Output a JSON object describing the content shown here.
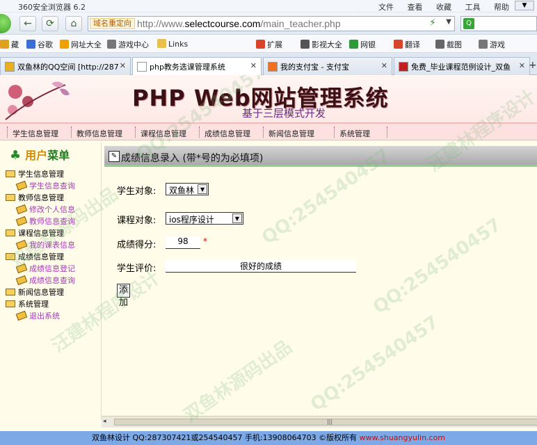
{
  "browser": {
    "app_title": "360安全浏览器 6.2",
    "menus": [
      "文件",
      "查看",
      "收藏",
      "工具",
      "帮助"
    ],
    "redirect_label": "域名重定向",
    "url_prefix": "http://www.",
    "url_domain": "selectcourse.com",
    "url_path": "/main_teacher.php"
  },
  "bookmarks": [
    {
      "label": "藏",
      "icon": "bookmark-icon",
      "color": "#e0a020"
    },
    {
      "label": "谷歌",
      "icon": "google-icon",
      "color": "#3b6fd8"
    },
    {
      "label": "网址大全",
      "icon": "site-icon",
      "color": "#f0a000"
    },
    {
      "label": "游戏中心",
      "icon": "game-icon",
      "color": "#777777"
    },
    {
      "label": "Links",
      "icon": "folder-icon",
      "color": "#e8c050"
    },
    {
      "label": "扩展",
      "icon": "extension-icon",
      "color": "#d9452b"
    },
    {
      "label": "影视大全",
      "icon": "video-icon",
      "color": "#555555"
    },
    {
      "label": "网银",
      "icon": "bank-icon",
      "color": "#2e9a3a"
    },
    {
      "label": "翻译",
      "icon": "translate-icon",
      "color": "#d9452b"
    },
    {
      "label": "截图",
      "icon": "screenshot-icon",
      "color": "#666666"
    },
    {
      "label": "游戏",
      "icon": "gamepad-icon",
      "color": "#777777"
    }
  ],
  "tabs": [
    {
      "label": "双鱼林的QQ空间 [http://287",
      "color": "#e8b020"
    },
    {
      "label": "php教务选课管理系统",
      "color": "#ffffff"
    },
    {
      "label": "我的支付宝 - 支付宝",
      "color": "#f07020"
    },
    {
      "label": "免费_毕业课程范例设计_双鱼",
      "color": "#c02020"
    }
  ],
  "site": {
    "title": "PHP Web网站管理系统",
    "subtitle": "基于三层模式开发",
    "topnav": [
      "学生信息管理",
      "教师信息管理",
      "课程信息管理",
      "成绩信息管理",
      "新闻信息管理",
      "系统管理"
    ]
  },
  "sidebar": {
    "head_user": "用户",
    "head_menu": "菜单",
    "items": [
      {
        "label": "学生信息管理",
        "level": "top"
      },
      {
        "label": "学生信息查询",
        "level": "sub"
      },
      {
        "label": "教师信息管理",
        "level": "top"
      },
      {
        "label": "修改个人信息",
        "level": "sub"
      },
      {
        "label": "教师信息查询",
        "level": "sub"
      },
      {
        "label": "课程信息管理",
        "level": "top"
      },
      {
        "label": "我的课表信息",
        "level": "sub"
      },
      {
        "label": "成绩信息管理",
        "level": "top"
      },
      {
        "label": "成绩信息登记",
        "level": "sub"
      },
      {
        "label": "成绩信息查询",
        "level": "sub"
      },
      {
        "label": "新闻信息管理",
        "level": "top"
      },
      {
        "label": "系统管理",
        "level": "top"
      },
      {
        "label": "退出系统",
        "level": "sub"
      }
    ]
  },
  "form": {
    "heading": "成绩信息录入 (带*号的为必填项)",
    "student_label": "学生对象:",
    "student_value": "双鱼林",
    "course_label": "课程对象:",
    "course_value": "ios程序设计",
    "score_label": "成绩得分:",
    "score_value": "98",
    "required_mark": "*",
    "comment_label": "学生评价:",
    "comment_value": "很好的成绩",
    "submit_label": "添加"
  },
  "footer": {
    "text": "双鱼林设计 QQ:287307421或254540457 手机:13908064703 ©版权所有 ",
    "site": "www.shuangyulin.com"
  },
  "watermarks": [
    "QQ:254540457",
    "汪建林程序设计",
    "双鱼林源码出品"
  ]
}
